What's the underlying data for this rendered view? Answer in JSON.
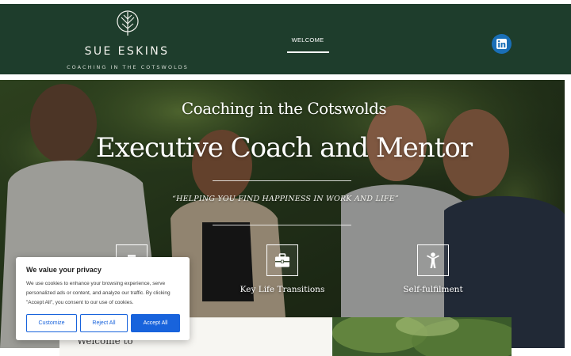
{
  "header": {
    "brand_name": "SUE ESKINS",
    "tagline": "COACHING IN THE COTSWOLDS",
    "nav": [
      {
        "label": "WELCOME",
        "active": true
      }
    ],
    "social": {
      "icon": "linkedin-icon",
      "color": "#1a6fb7"
    },
    "background_color": "#1e3d2c"
  },
  "hero": {
    "heading_small": "Coaching in the Cotswolds",
    "heading_large": "Executive Coach and Mentor",
    "quote": "“HELPING YOU FIND HAPPINESS IN WORK AND LIFE”",
    "features": [
      {
        "icon": "career-icon",
        "label": ""
      },
      {
        "icon": "briefcase-icon",
        "label": "Key Life Transitions"
      },
      {
        "icon": "person-icon",
        "label": "Self-fulfilment"
      }
    ]
  },
  "welcome": {
    "text": "Welcome to"
  },
  "cookie_banner": {
    "title": "We value your privacy",
    "body": "We use cookies to enhance your browsing experience, serve personalized ads or content, and analyze our traffic. By clicking \"Accept All\", you consent to our use of cookies.",
    "buttons": {
      "customize": "Customize",
      "reject": "Reject All",
      "accept": "Accept All"
    },
    "accent_color": "#1863dc"
  }
}
